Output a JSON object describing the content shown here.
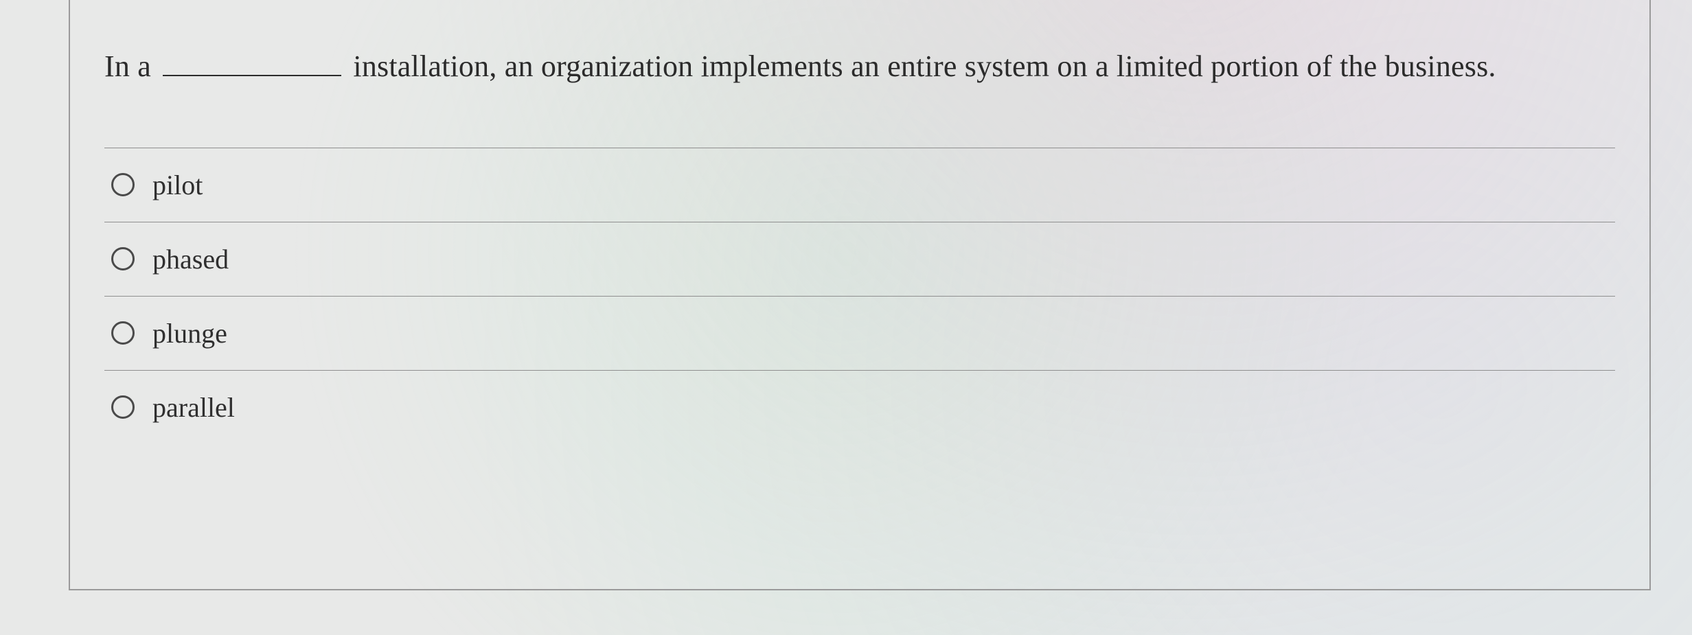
{
  "question": {
    "pre": "In a",
    "post": "installation, an organization implements an entire system on a limited portion of the business."
  },
  "options": [
    {
      "label": "pilot"
    },
    {
      "label": "phased"
    },
    {
      "label": "plunge"
    },
    {
      "label": "parallel"
    }
  ]
}
